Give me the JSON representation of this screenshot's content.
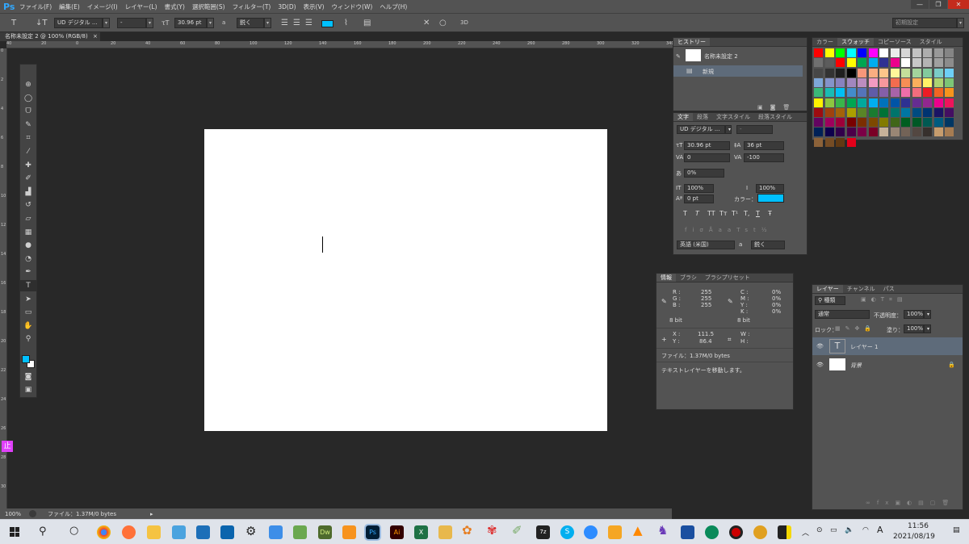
{
  "app": {
    "logo": "Ps"
  },
  "menu": [
    "ファイル(F)",
    "編集(E)",
    "イメージ(I)",
    "レイヤー(L)",
    "書式(Y)",
    "選択範囲(S)",
    "フィルター(T)",
    "3D(D)",
    "表示(V)",
    "ウィンドウ(W)",
    "ヘルプ(H)"
  ],
  "window_controls": {
    "minimize": "—",
    "restore": "❐",
    "close": "✕"
  },
  "options": {
    "font_family": "UD デジタル ...",
    "font_style": "-",
    "font_size": "30.96 pt",
    "aa_label": "a",
    "antialias": "鋭く",
    "color": "#00c0ff",
    "workspace": "初期設定",
    "cancel": "✕",
    "commit": "○",
    "three_d": "3D"
  },
  "document": {
    "tab": "名称未設定 2 @ 100% (RGB/8)",
    "tab_close": "×"
  },
  "ruler": {
    "h_ticks": [
      "40",
      "20",
      "0",
      "20",
      "40",
      "60",
      "80",
      "100",
      "120",
      "140",
      "160",
      "180",
      "200",
      "220",
      "240",
      "260",
      "280",
      "300",
      "320",
      "340"
    ],
    "v_ticks": [
      "0",
      "2",
      "4",
      "6",
      "8",
      "10",
      "12",
      "14",
      "16",
      "18",
      "20",
      "22",
      "24",
      "26",
      "28",
      "30"
    ]
  },
  "toolbar": {
    "tools": [
      "move",
      "marquee",
      "lasso",
      "quick-select",
      "crop",
      "eyedropper",
      "healing",
      "brush",
      "stamp",
      "history-brush",
      "eraser",
      "gradient",
      "blur",
      "dodge",
      "pen",
      "type",
      "path-select",
      "shape",
      "hand",
      "zoom"
    ],
    "foreground": "#00c0ff",
    "background": "#ffffff"
  },
  "left_badge": "止",
  "status": {
    "zoom": "100%",
    "file": "ファイル：1.37M/0 bytes"
  },
  "history": {
    "tabs": [
      "ヒストリー"
    ],
    "snapshot": "名称未設定 2",
    "items": [
      "新規"
    ]
  },
  "character": {
    "tabs": [
      "文字",
      "段落",
      "文字スタイル",
      "段落スタイル"
    ],
    "font_family": "UD デジタル ...",
    "font_style": "-",
    "size": "30.96 pt",
    "leading": "36 pt",
    "kerning": "0",
    "tracking": "-100",
    "tsume": "0%",
    "vscale": "100%",
    "hscale": "100%",
    "baseline": "0 pt",
    "color_label": "カラー：",
    "color": "#00c0ff",
    "style_buttons": [
      "T",
      "T",
      "TT",
      "Tт",
      "T¹",
      "T,",
      "T",
      "Ŧ"
    ],
    "language": "英語 (米国)",
    "aa_label": "a",
    "antialias": "鋭く"
  },
  "info": {
    "tabs": [
      "情報",
      "ブラシ",
      "ブラシプリセット"
    ],
    "rgb": {
      "R": "255",
      "G": "255",
      "B": "255"
    },
    "cmyk": {
      "C": "0%",
      "M": "0%",
      "Y": "0%",
      "K": "0%"
    },
    "bit_left": "8 bit",
    "bit_right": "8 bit",
    "x": "111.5",
    "y": "86.4",
    "w_label": "W :",
    "h_label": "H :",
    "file": "ファイル：1.37M/0 bytes",
    "hint": "テキストレイヤーを移動します。"
  },
  "swatches": {
    "tabs": [
      "カラー",
      "スウォッチ",
      "コピーソース",
      "スタイル"
    ],
    "colors": [
      "#ff0000",
      "#ffff00",
      "#00ff00",
      "#00ffff",
      "#0000ff",
      "#ff00ff",
      "#ffffff",
      "#ebebeb",
      "#d6d6d6",
      "#c2c2c2",
      "#adadad",
      "#999999",
      "#858585",
      "#707070",
      "#5c5c5c",
      "#ff0000",
      "#ffff00",
      "#00a651",
      "#00aeef",
      "#2e3192",
      "#ec008c",
      "#ffffff",
      "#c8c8c8",
      "#b4b4b4",
      "#a0a0a0",
      "#8c8c8c",
      "#474747",
      "#333333",
      "#1f1f1f",
      "#000000",
      "#f7977a",
      "#f9ad81",
      "#fdc68a",
      "#fff79a",
      "#c4df9b",
      "#a3d39c",
      "#82ca9d",
      "#7accc8",
      "#6dcff6",
      "#7ea7d8",
      "#8493ca",
      "#8882be",
      "#a187be",
      "#bc8dbf",
      "#f49ac2",
      "#f6989d",
      "#f26c4f",
      "#f68e55",
      "#fbaf5c",
      "#fff467",
      "#acd372",
      "#7cc576",
      "#3bb878",
      "#1abbb4",
      "#00bff3",
      "#438ccb",
      "#5574b9",
      "#605ca8",
      "#855fa8",
      "#a763a8",
      "#f06ea9",
      "#f26d7d",
      "#ed1c24",
      "#f26522",
      "#f7941d",
      "#fff200",
      "#8dc73f",
      "#39b54a",
      "#00a651",
      "#00a99d",
      "#00aeef",
      "#0072bc",
      "#0054a6",
      "#2e3192",
      "#662d91",
      "#92278f",
      "#ec008c",
      "#ed145b",
      "#9e0b0f",
      "#a0410d",
      "#a36209",
      "#aba000",
      "#598527",
      "#1a7b30",
      "#007236",
      "#00746b",
      "#0076a3",
      "#004b80",
      "#003471",
      "#1b1464",
      "#440e62",
      "#630460",
      "#9e005d",
      "#9e0039",
      "#790000",
      "#7b2e00",
      "#7d4900",
      "#827b00",
      "#406618",
      "#005e20",
      "#005826",
      "#005952",
      "#005b7f",
      "#003663",
      "#002157",
      "#0d004c",
      "#32004b",
      "#4b0049",
      "#7b0046",
      "#7a0026",
      "#c7b299",
      "#998675",
      "#736357",
      "#534741",
      "#37302d",
      "#c69c6d",
      "#a67c52",
      "#8c6239",
      "#754c24",
      "#603913",
      "#e2001a"
    ]
  },
  "layers": {
    "tabs": [
      "レイヤー",
      "チャンネル",
      "パス"
    ],
    "filter": "種類",
    "blend": "通常",
    "opacity_label": "不透明度：",
    "opacity": "100%",
    "lock_label": "ロック：",
    "fill_label": "塗り：",
    "fill": "100%",
    "items": [
      {
        "name": "レイヤー 1",
        "thumb": "T",
        "selected": true
      },
      {
        "name": "背景",
        "thumb": "",
        "selected": false
      }
    ]
  },
  "taskbar": {
    "time": "11:56",
    "date": "2021/08/19",
    "ime": "A"
  }
}
